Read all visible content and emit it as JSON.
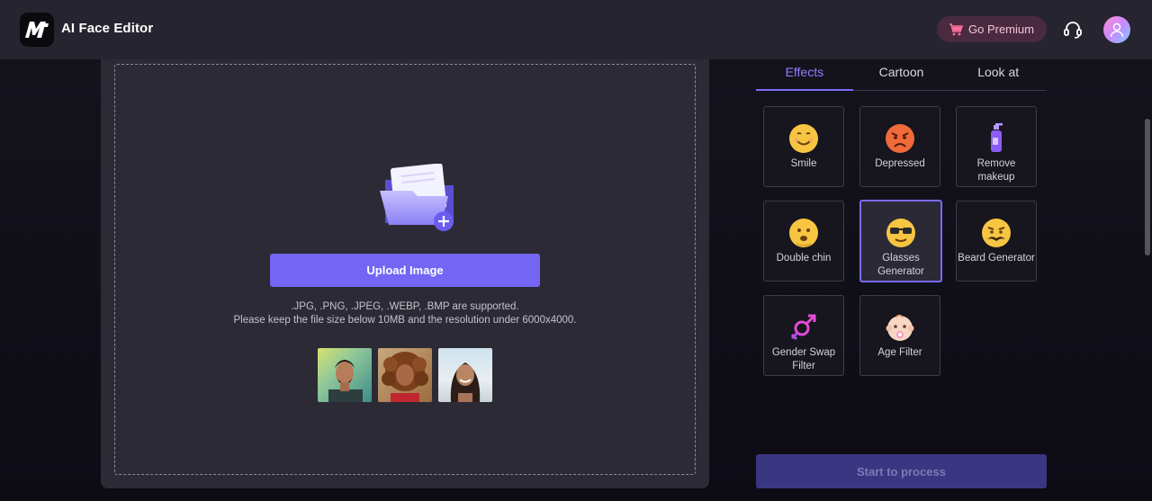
{
  "header": {
    "logo_text": "M",
    "app_title": "AI Face Editor",
    "premium_label": "Go Premium"
  },
  "upload": {
    "button_label": "Upload Image",
    "supported_formats": ".JPG, .PNG, .JPEG, .WEBP, .BMP are supported.",
    "size_note": "Please keep the file size below 10MB and the resolution under 6000x4000."
  },
  "tabs": [
    {
      "label": "Effects",
      "active": true
    },
    {
      "label": "Cartoon",
      "active": false
    },
    {
      "label": "Look at",
      "active": false
    }
  ],
  "effects": [
    {
      "label": "Smile",
      "icon": "smile-emoji-icon"
    },
    {
      "label": "Depressed",
      "icon": "angry-emoji-icon"
    },
    {
      "label": "Remove makeup",
      "icon": "makeup-bottle-icon"
    },
    {
      "label": "Double chin",
      "icon": "double-chin-emoji-icon"
    },
    {
      "label": "Glasses Generator",
      "icon": "sunglasses-emoji-icon",
      "selected": true
    },
    {
      "label": "Beard Generator",
      "icon": "mustache-emoji-icon"
    },
    {
      "label": "Gender Swap Filter",
      "icon": "gender-symbol-icon"
    },
    {
      "label": "Age Filter",
      "icon": "baby-face-icon"
    }
  ],
  "actions": {
    "process_label": "Start to process"
  },
  "colors": {
    "accent": "#7465f4",
    "topbar": "#26252f",
    "panel": "#2c2b35"
  }
}
